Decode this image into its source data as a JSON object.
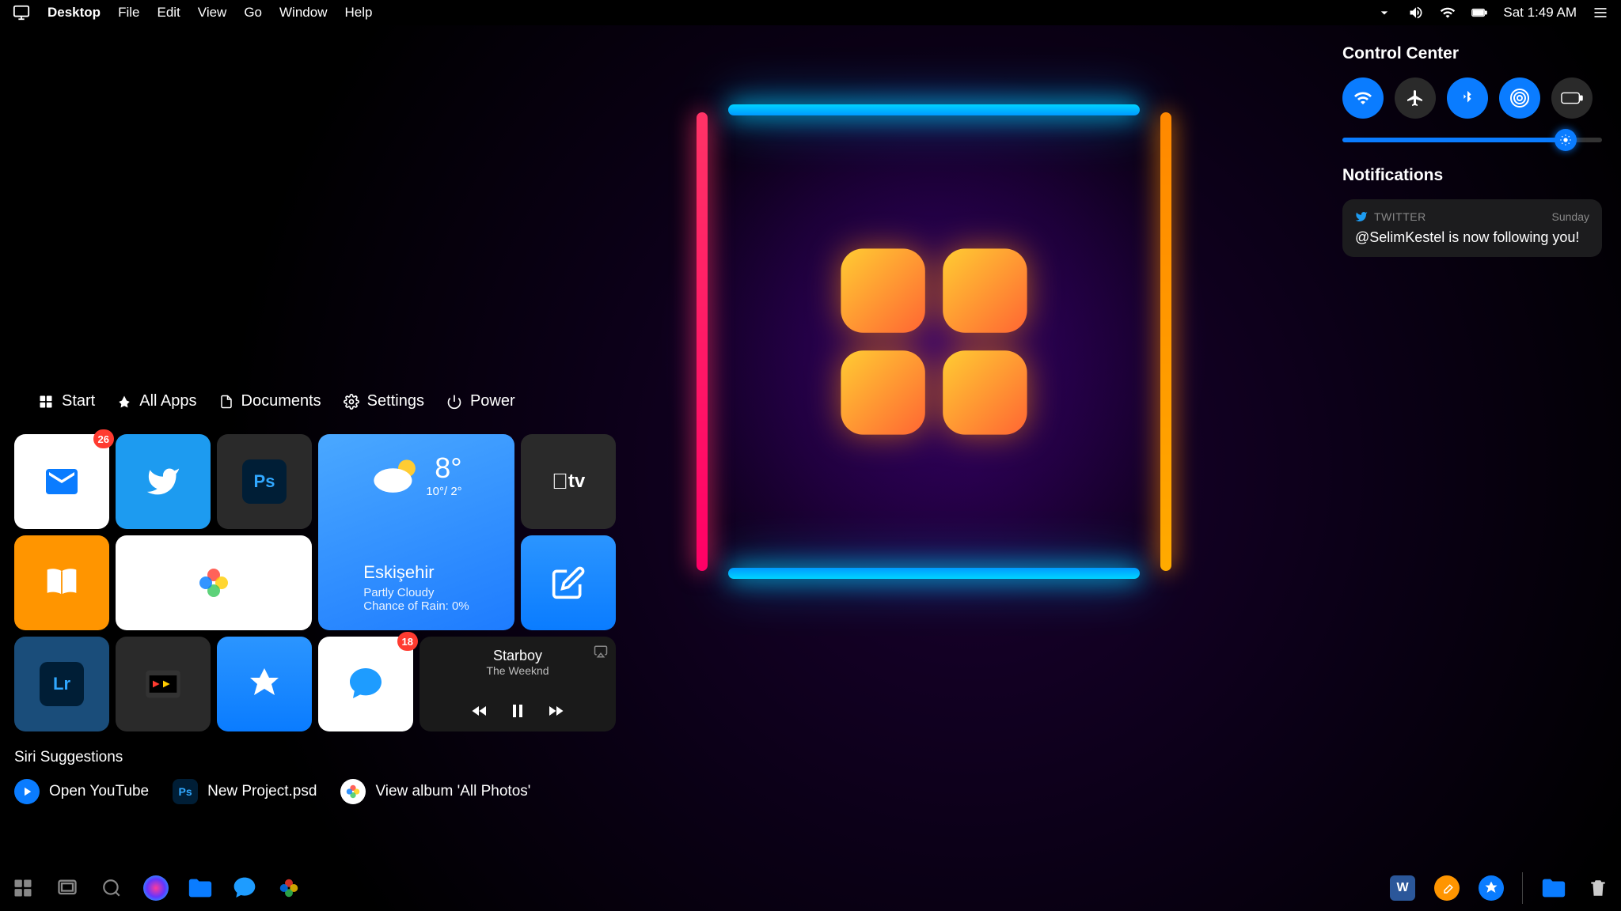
{
  "menubar": {
    "app": "Desktop",
    "items": [
      "File",
      "Edit",
      "View",
      "Go",
      "Window",
      "Help"
    ],
    "clock": "Sat 1:49 AM"
  },
  "start": {
    "tabs": {
      "start": "Start",
      "allapps": "All Apps",
      "documents": "Documents",
      "settings": "Settings",
      "power": "Power"
    },
    "mail_badge": "26",
    "messages_badge": "18",
    "weather": {
      "temp": "8°",
      "range": "10°/ 2°",
      "location": "Eskişehir",
      "conditions": "Partly Cloudy",
      "rain": "Chance of Rain: 0%"
    },
    "music": {
      "title": "Starboy",
      "artist": "The Weeknd"
    },
    "siri_heading": "Siri Suggestions",
    "siri": {
      "youtube": "Open YouTube",
      "psd": "New Project.psd",
      "photos": "View album 'All Photos'"
    }
  },
  "cc": {
    "heading": "Control Center",
    "notif_heading": "Notifications",
    "notif": {
      "app": "TWITTER",
      "time": "Sunday",
      "body": "@SelimKestel is now following you!"
    }
  }
}
